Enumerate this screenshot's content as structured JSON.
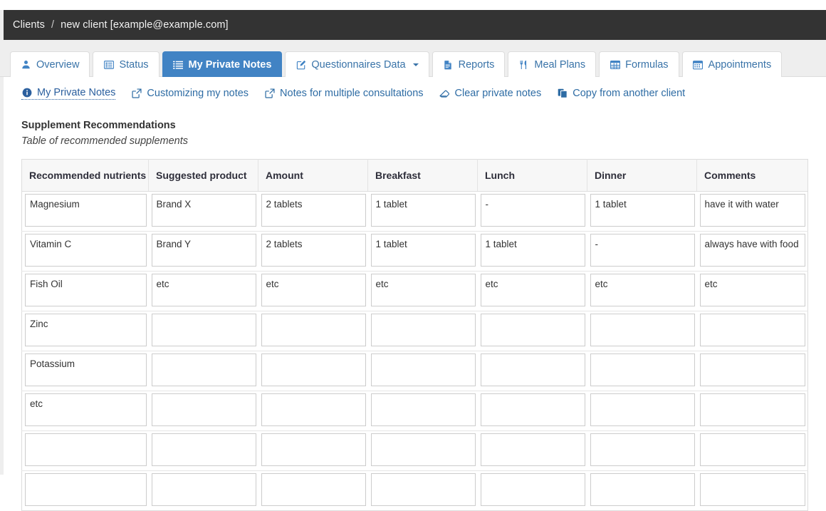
{
  "breadcrumb": {
    "root": "Clients",
    "separator": "/",
    "current": "new client [example@example.com]"
  },
  "tabs": [
    {
      "label": "Overview",
      "icon": "user-icon",
      "active": false,
      "caret": false
    },
    {
      "label": "Status",
      "icon": "list-alt-icon",
      "active": false,
      "caret": false
    },
    {
      "label": "My Private Notes",
      "icon": "list-icon",
      "active": true,
      "caret": false
    },
    {
      "label": "Questionnaires Data",
      "icon": "edit-square-icon",
      "active": false,
      "caret": true
    },
    {
      "label": "Reports",
      "icon": "file-text-icon",
      "active": false,
      "caret": false
    },
    {
      "label": "Meal Plans",
      "icon": "cutlery-icon",
      "active": false,
      "caret": false
    },
    {
      "label": "Formulas",
      "icon": "table-grid-icon",
      "active": false,
      "caret": false
    },
    {
      "label": "Appointments",
      "icon": "calendar-icon",
      "active": false,
      "caret": false
    }
  ],
  "subnav": [
    {
      "label": "My Private Notes",
      "icon": "info-circle-icon",
      "current": true
    },
    {
      "label": "Customizing my notes",
      "icon": "external-link-icon",
      "current": false
    },
    {
      "label": "Notes for multiple consultations",
      "icon": "external-link-icon",
      "current": false
    },
    {
      "label": "Clear private notes",
      "icon": "eraser-icon",
      "current": false
    },
    {
      "label": "Copy from another client",
      "icon": "copy-icon",
      "current": false
    }
  ],
  "section": {
    "title": "Supplement Recommendations",
    "subtitle": "Table of recommended supplements"
  },
  "table": {
    "columns": [
      "Recommended nutrients",
      "Suggested product",
      "Amount",
      "Breakfast",
      "Lunch",
      "Dinner",
      "Comments"
    ],
    "rows": [
      [
        "Magnesium",
        "Brand X",
        "2 tablets",
        "1 tablet",
        "-",
        "1 tablet",
        "have it with water"
      ],
      [
        "Vitamin C",
        "Brand Y",
        "2 tablets",
        "1 tablet",
        "1 tablet",
        "-",
        "always have with food"
      ],
      [
        "Fish Oil",
        "etc",
        "etc",
        "etc",
        "etc",
        "etc",
        "etc"
      ],
      [
        "Zinc",
        "",
        "",
        "",
        "",
        "",
        ""
      ],
      [
        "Potassium",
        "",
        "",
        "",
        "",
        "",
        ""
      ],
      [
        "etc",
        "",
        "",
        "",
        "",
        "",
        ""
      ],
      [
        "",
        "",
        "",
        "",
        "",
        "",
        ""
      ],
      [
        "",
        "",
        "",
        "",
        "",
        "",
        ""
      ]
    ]
  },
  "colors": {
    "header_bar": "#333333",
    "active_tab": "#4183c4",
    "link": "#2e6ca4",
    "tab_strip_bg": "#eeeeee"
  }
}
